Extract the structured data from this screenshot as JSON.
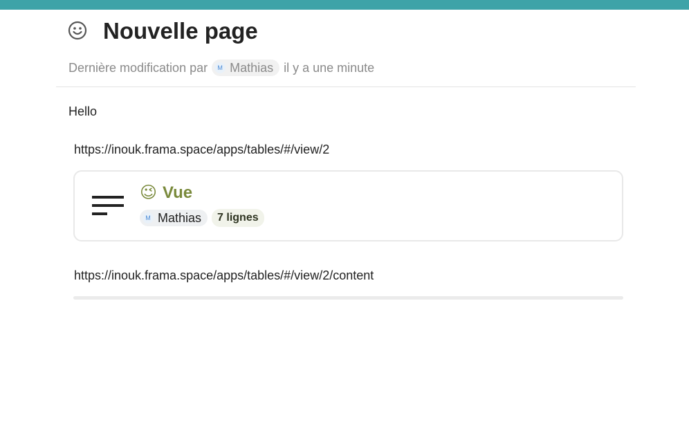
{
  "page": {
    "title": "Nouvelle page",
    "emoji_icon": "smiley-icon",
    "last_modified": {
      "prefix": "Dernière modification par",
      "user_initial": "M",
      "user_name": "Mathias",
      "suffix": "il y a une minute"
    }
  },
  "content": {
    "paragraph": "Hello",
    "link1": "https://inouk.frama.space/apps/tables/#/view/2",
    "card": {
      "icon": "table-view-icon",
      "emoji": "😉",
      "title": "Vue",
      "owner_initial": "M",
      "owner_name": "Mathias",
      "rows_badge": "7 lignes"
    },
    "link2": "https://inouk.frama.space/apps/tables/#/view/2/content"
  },
  "colors": {
    "top_bar": "#3ea3a8",
    "card_title": "#7a8a3c"
  }
}
